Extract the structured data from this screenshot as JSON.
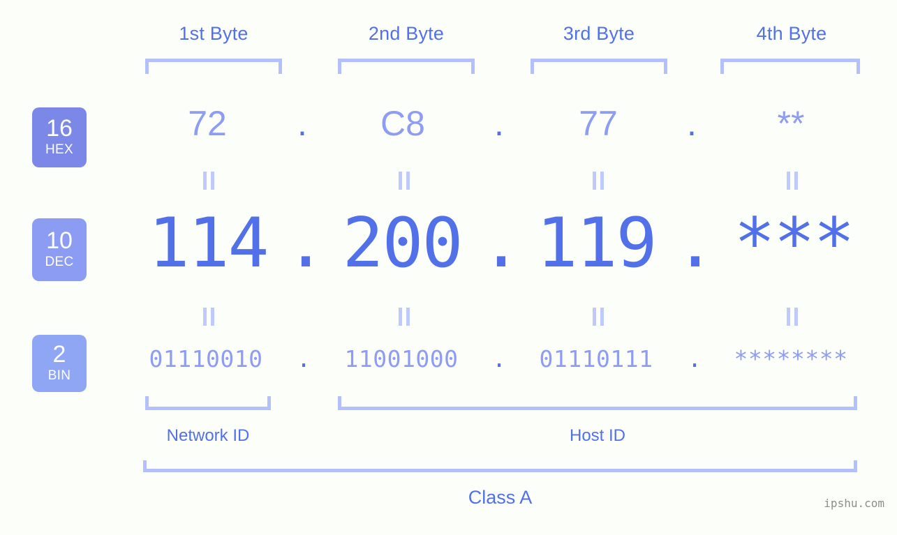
{
  "background_color": "#fcfef9",
  "accent_colors": {
    "strong_blue": "#5271e8",
    "mid_blue": "#8e9cf2",
    "light_blue": "#b4c0fb",
    "badge_hex": "#7b88e8",
    "badge_dec": "#8b9cf2",
    "badge_bin": "#8fa6f5",
    "watermark_gray": "#8a8f8a"
  },
  "byte_headers": [
    {
      "label": "1st Byte"
    },
    {
      "label": "2nd Byte"
    },
    {
      "label": "3rd Byte"
    },
    {
      "label": "4th Byte"
    }
  ],
  "bases": [
    {
      "number": "16",
      "name": "HEX"
    },
    {
      "number": "10",
      "name": "DEC"
    },
    {
      "number": "2",
      "name": "BIN"
    }
  ],
  "rows": {
    "hex": {
      "values": [
        "72",
        "C8",
        "77",
        "**"
      ],
      "separators": [
        ".",
        ".",
        "."
      ]
    },
    "dec": {
      "values": [
        "114",
        "200",
        "119",
        "***"
      ],
      "separators": [
        ".",
        ".",
        "."
      ]
    },
    "bin": {
      "values": [
        "01110010",
        "11001000",
        "01110111",
        "********"
      ],
      "separators": [
        ".",
        ".",
        "."
      ]
    }
  },
  "equality_markers": {
    "glyph": "=",
    "rotated": true,
    "count_per_gap": 4,
    "gaps": 2
  },
  "sections": [
    {
      "label": "Network ID"
    },
    {
      "label": "Host ID"
    }
  ],
  "class": {
    "label": "Class A"
  },
  "watermark": {
    "text": "ipshu.com"
  }
}
